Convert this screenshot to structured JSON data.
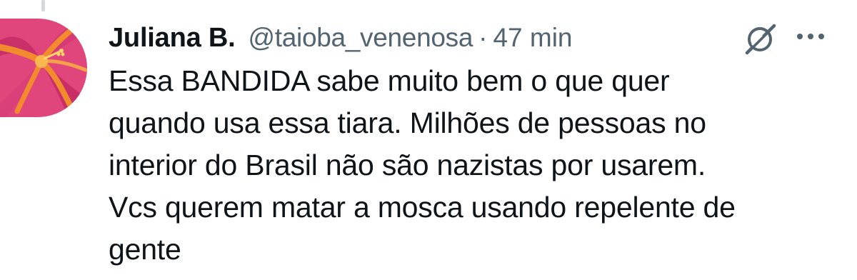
{
  "tweet": {
    "display_name": "Juliana B.",
    "handle": "@taioba_venenosa",
    "separator": "·",
    "time": "47 min",
    "text_lines": [
      "Essa BANDIDA sabe muito bem o que quer",
      "quando usa essa tiara. Milhões de pessoas no",
      "interior do Brasil não são nazistas por usarem.",
      "Vcs querem matar a mosca usando repelente de",
      "gente"
    ]
  },
  "icons": {
    "avatar": "hibiscus-flower-avatar",
    "grok": "grok-icon",
    "more": "more-icon"
  },
  "colors": {
    "text_primary": "#0f1419",
    "text_secondary": "#536471",
    "avatar_background": "#e0457b",
    "avatar_accent": "#f28a2e"
  }
}
